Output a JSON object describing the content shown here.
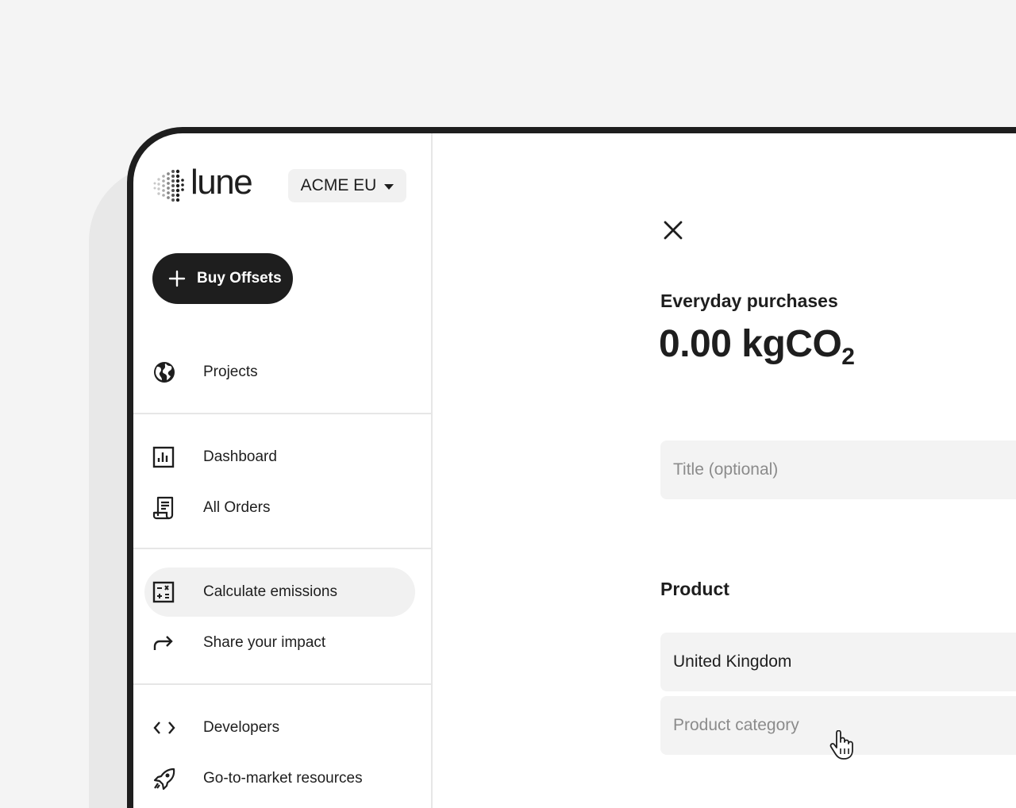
{
  "brand": {
    "name": "lune"
  },
  "account": {
    "name": "ACME EU"
  },
  "actions": {
    "buy_offsets": "Buy Offsets"
  },
  "nav": {
    "projects": "Projects",
    "dashboard": "Dashboard",
    "all_orders": "All Orders",
    "calculate_emissions": "Calculate emissions",
    "share_impact": "Share your impact",
    "developers": "Developers",
    "gtm_resources": "Go-to-market resources"
  },
  "panel": {
    "category": "Everyday purchases",
    "value": "0.00",
    "unit": "kgCO",
    "unit_sub": "2",
    "title_placeholder": "Title (optional)",
    "product_heading": "Product",
    "country": "United Kingdom",
    "product_category_placeholder": "Product category"
  },
  "colors": {
    "primary": "#1e1e1e",
    "surface": "#f3f3f3",
    "background": "#f4f4f4"
  }
}
